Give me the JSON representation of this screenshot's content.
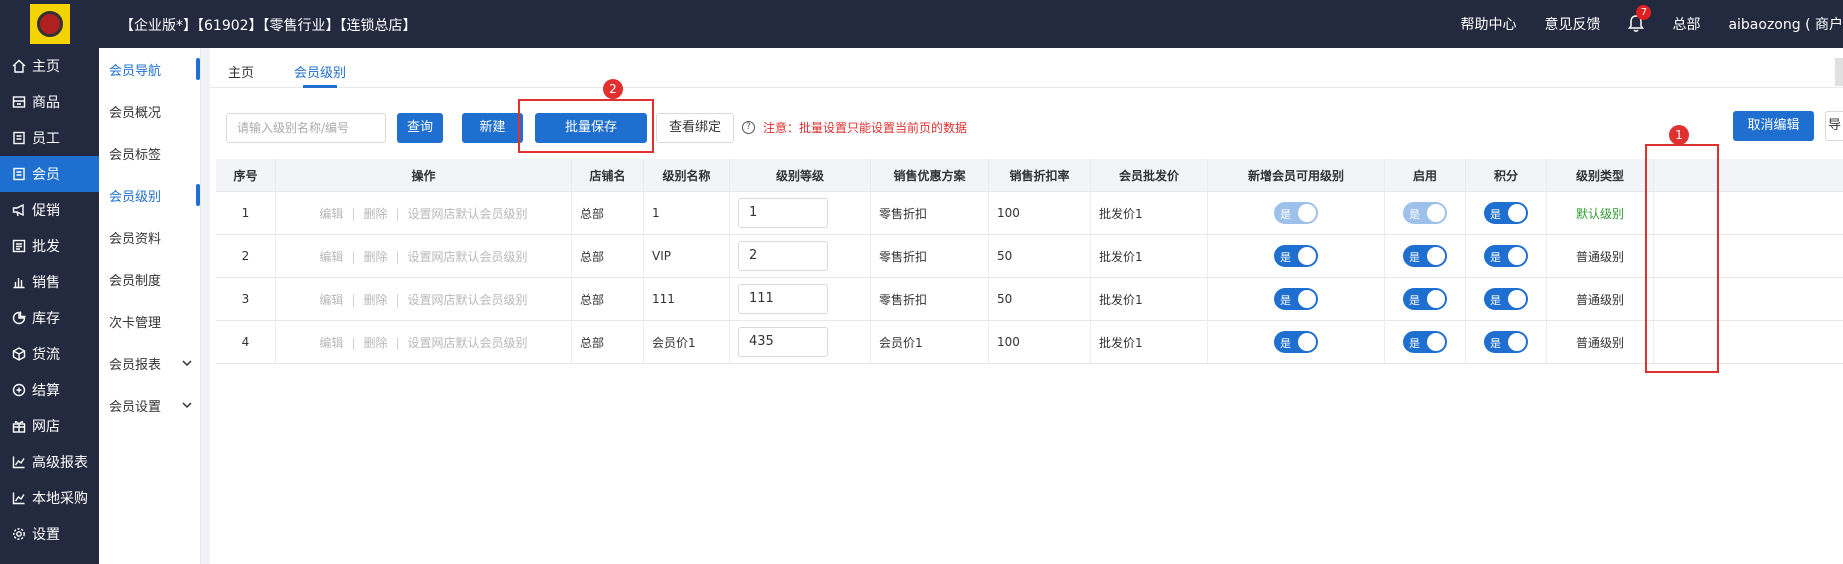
{
  "header": {
    "shop_title": "【企业版*】【61902】【零售行业】【连锁总店】",
    "help": "帮助中心",
    "feedback": "意见反馈",
    "notification_count": "7",
    "store": "总部",
    "user": "aibaozong ( 商户"
  },
  "sidebar": {
    "items": [
      {
        "label": "主页",
        "icon": "home-icon"
      },
      {
        "label": "商品",
        "icon": "box-icon"
      },
      {
        "label": "员工",
        "icon": "staff-icon"
      },
      {
        "label": "会员",
        "icon": "member-icon",
        "active": true
      },
      {
        "label": "促销",
        "icon": "megaphone-icon"
      },
      {
        "label": "批发",
        "icon": "list-icon"
      },
      {
        "label": "销售",
        "icon": "bar-chart-icon"
      },
      {
        "label": "库存",
        "icon": "pie-icon"
      },
      {
        "label": "货流",
        "icon": "cube-icon"
      },
      {
        "label": "结算",
        "icon": "settle-icon"
      },
      {
        "label": "网店",
        "icon": "gift-icon"
      },
      {
        "label": "高级报表",
        "icon": "line-chart-icon"
      },
      {
        "label": "本地采购",
        "icon": "trend-icon"
      },
      {
        "label": "设置",
        "icon": "gear-icon"
      }
    ]
  },
  "submenu": {
    "items": [
      {
        "label": "会员导航"
      },
      {
        "label": "会员概况"
      },
      {
        "label": "会员标签"
      },
      {
        "label": "会员级别"
      },
      {
        "label": "会员资料"
      },
      {
        "label": "会员制度"
      },
      {
        "label": "次卡管理"
      },
      {
        "label": "会员报表"
      },
      {
        "label": "会员设置"
      }
    ]
  },
  "tabs": {
    "home": "主页",
    "member_level": "会员级别"
  },
  "toolbar": {
    "search_placeholder": "请输入级别名称/编号",
    "query": "查询",
    "new": "新建",
    "batch_save": "批量保存",
    "view_binding": "查看绑定",
    "hint": "注意：批量设置只能设置当前页的数据",
    "cancel_edit": "取消编辑",
    "cut_off_btn": "导"
  },
  "annotations": {
    "one": "1",
    "two": "2"
  },
  "table": {
    "headers": {
      "seq": "序号",
      "ops": "操作",
      "store": "店铺名",
      "name": "级别名称",
      "level": "级别等级",
      "plan": "销售优惠方案",
      "rate": "销售折扣率",
      "wholesale": "会员批发价",
      "new_member": "新增会员可用级别",
      "enable": "启用",
      "points": "积分",
      "type": "级别类型"
    },
    "op_edit": "编辑",
    "op_delete": "删除",
    "op_default": "设置网店默认会员级别",
    "toggle_text": "是",
    "rows": [
      {
        "seq": "1",
        "store": "总部",
        "name": "1",
        "level": "1",
        "plan": "零售折扣",
        "rate": "100",
        "wholesale": "批发价1",
        "type": "默认级别"
      },
      {
        "seq": "2",
        "store": "总部",
        "name": "VIP",
        "level": "2",
        "plan": "零售折扣",
        "rate": "50",
        "wholesale": "批发价1",
        "type": "普通级别"
      },
      {
        "seq": "3",
        "store": "总部",
        "name": "111",
        "level": "111",
        "plan": "零售折扣",
        "rate": "50",
        "wholesale": "批发价1",
        "type": "普通级别"
      },
      {
        "seq": "4",
        "store": "总部",
        "name": "会员价1",
        "level": "435",
        "plan": "会员价1",
        "rate": "100",
        "wholesale": "批发价1",
        "type": "普通级别"
      }
    ]
  },
  "colors": {
    "primary": "#1f6fd0",
    "header_bg": "#232a3f",
    "alert": "#e03030",
    "default_level": "#2e9e2e"
  }
}
